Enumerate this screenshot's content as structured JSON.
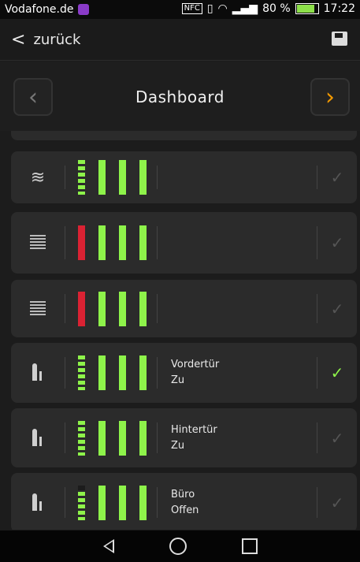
{
  "status": {
    "carrier": "Vodafone.de",
    "nfc": "NFC",
    "battery": "80 %",
    "time": "17:22"
  },
  "topbar": {
    "back_label": "zurück"
  },
  "nav": {
    "title": "Dashboard"
  },
  "cards": [
    {
      "icon": "wind-icon",
      "label1": "",
      "label2": "",
      "checked": false
    },
    {
      "icon": "blind-icon",
      "label1": "",
      "label2": "",
      "checked": false
    },
    {
      "icon": "blind-icon",
      "label1": "",
      "label2": "",
      "checked": false
    },
    {
      "icon": "door-icon",
      "label1": "Vordertür",
      "label2": "Zu",
      "checked": true
    },
    {
      "icon": "door-icon",
      "label1": "Hintertür",
      "label2": "Zu",
      "checked": false
    },
    {
      "icon": "door-icon",
      "label1": "Büro",
      "label2": "Offen",
      "checked": false
    }
  ],
  "colors": {
    "accent": "#f29900",
    "green": "#8ef34a",
    "red": "#da2233"
  }
}
